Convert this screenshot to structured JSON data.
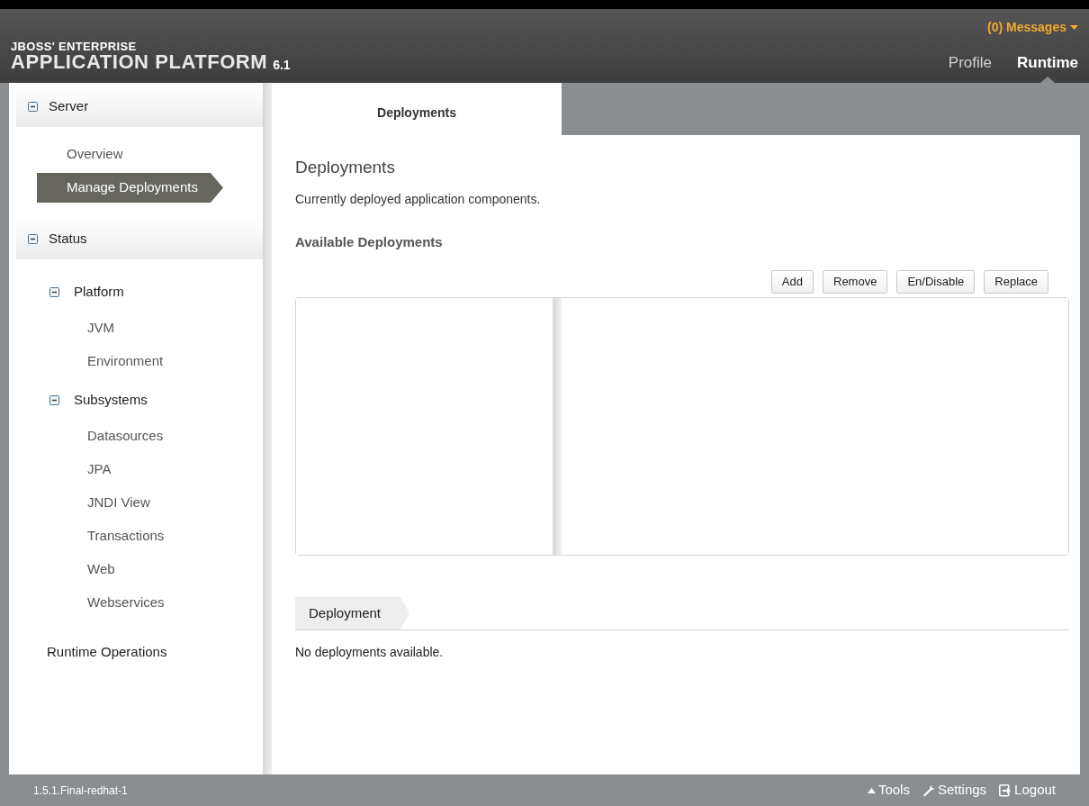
{
  "header": {
    "logo_top": "JBOSS' ENTERPRISE",
    "logo_main": "APPLICATION PLATFORM",
    "version": "6.1",
    "messages": "(0) Messages",
    "tabs": [
      {
        "label": "Profile",
        "selected": false
      },
      {
        "label": "Runtime",
        "selected": true
      }
    ]
  },
  "sidebar": [
    {
      "kind": "section",
      "label": "Server",
      "expanded": true,
      "children": [
        {
          "kind": "item",
          "label": "Overview",
          "selected": false
        },
        {
          "kind": "item",
          "label": "Manage Deployments",
          "selected": true
        }
      ]
    },
    {
      "kind": "section",
      "label": "Status",
      "expanded": true,
      "children": [
        {
          "kind": "group",
          "label": "Platform",
          "expanded": true,
          "children": [
            {
              "kind": "item",
              "label": "JVM",
              "selected": false
            },
            {
              "kind": "item",
              "label": "Environment",
              "selected": false
            }
          ]
        },
        {
          "kind": "group",
          "label": "Subsystems",
          "expanded": true,
          "children": [
            {
              "kind": "item",
              "label": "Datasources",
              "selected": false
            },
            {
              "kind": "item",
              "label": "JPA",
              "selected": false
            },
            {
              "kind": "item",
              "label": "JNDI View",
              "selected": false
            },
            {
              "kind": "item",
              "label": "Transactions",
              "selected": false
            },
            {
              "kind": "item",
              "label": "Web",
              "selected": false
            },
            {
              "kind": "item",
              "label": "Webservices",
              "selected": false
            }
          ]
        }
      ]
    },
    {
      "kind": "link",
      "label": "Runtime Operations"
    }
  ],
  "content": {
    "tabs": [
      {
        "label": "Deployments",
        "selected": true
      }
    ],
    "title": "Deployments",
    "description": "Currently deployed application components.",
    "subtitle": "Available Deployments",
    "buttons": [
      "Add",
      "Remove",
      "En/Disable",
      "Replace"
    ],
    "detail_tab": "Deployment",
    "empty_message": "No deployments available."
  },
  "footer": {
    "version": "1.5.1.Final-redhat-1",
    "links": [
      {
        "kind": "tools",
        "label": "Tools"
      },
      {
        "kind": "settings",
        "label": "Settings"
      },
      {
        "kind": "logout",
        "label": "Logout"
      }
    ]
  }
}
